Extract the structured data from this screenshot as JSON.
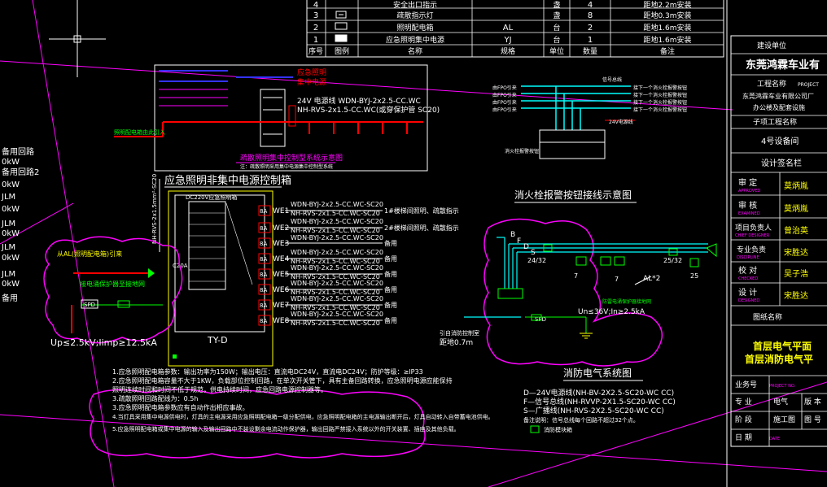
{
  "colors": {
    "bg": "#000000",
    "line_white": "#ffffff",
    "line_magenta": "#ff00ff",
    "line_cyan": "#00ffff",
    "line_green": "#00ff00",
    "line_red": "#ff0000",
    "line_yellow": "#ffff00",
    "line_blue": "#3333ff"
  },
  "top_table": {
    "rows": [
      {
        "no": "4",
        "name": "安全出口指示",
        "model": "",
        "unit": "盏",
        "qty": "4",
        "note": "距地2.2m安装"
      },
      {
        "no": "3",
        "name": "疏散指示灯",
        "model": "",
        "unit": "盏",
        "qty": "8",
        "note": "距地0.3m安装"
      },
      {
        "no": "2",
        "name": "照明配电箱",
        "model": "AL",
        "unit": "台",
        "qty": "2",
        "note": "距地1.6m安装"
      },
      {
        "no": "1",
        "name": "应急照明集中电源",
        "model": "YJ",
        "unit": "台",
        "qty": "1",
        "note": "距地1.6m安装"
      }
    ],
    "header": {
      "no": "序号",
      "symbol": "图例",
      "name": "名称",
      "model": "规格",
      "unit": "单位",
      "qty": "数量",
      "note": "备注"
    }
  },
  "left_edge_labels": [
    "备用回路",
    "0kW",
    "备用回路2",
    "0kW",
    "JLM",
    "0kW",
    "JLM",
    "0kW",
    "JLM",
    "0kW",
    "备用"
  ],
  "diagram_top": {
    "wire1": "24V 电源线 WDN-BYJ-2x2.5-CC.WC",
    "wire2": "NH-RVS-2x1.5-CC.WC(或穿保护管 SC20)",
    "label_red": "应急照明",
    "label_red2": "集中电源",
    "caption": "疏散照明集中控制型系统示意图",
    "note": "注：疏散照明采用集中电源集中控制型系统",
    "label_left": "照明配电箱由此引入"
  },
  "main_box": {
    "title": "应急照明非集中电源控制箱",
    "name": "TY-D",
    "header": "DC220V应急照明箱",
    "breaker": "C20A",
    "circuits": [
      {
        "id": "WE1",
        "breaker": "8A",
        "cable": "WDN-BYJ-2x2.5-CC.WC-SC20",
        "cable2": "NH-RVS-2x1.5-CC.WC-SC20",
        "desc": "1#楼梯间照明、疏散指示"
      },
      {
        "id": "WE2",
        "breaker": "8A",
        "cable": "WDN-BYJ-2x2.5-CC.WC-SC20",
        "cable2": "NH-RVS-2x1.5-CC.WC-SC20",
        "desc": "2#楼梯间照明、疏散指示"
      },
      {
        "id": "WE3",
        "breaker": "8A",
        "cable": "WDN-BYJ-2x2.5-CC.WC-SC20",
        "cable2": "",
        "desc": "备用"
      },
      {
        "id": "WE4",
        "breaker": "8A",
        "cable": "WDN-BYJ-2x2.5-CC.WC-SC20",
        "cable2": "NH-RVS-2x1.5-CC.WC-SC20",
        "desc": "备用"
      },
      {
        "id": "WE5",
        "breaker": "8A",
        "cable": "WDN-BYJ-2x2.5-CC.WC-SC20",
        "cable2": "NH-RVS-2x1.5-CC.WC-SC20",
        "desc": "备用"
      },
      {
        "id": "WE6",
        "breaker": "8A",
        "cable": "WDN-BYJ-2x2.5-CC.WC-SC20",
        "cable2": "NH-RVS-2x1.5-CC.WC-SC20",
        "desc": "备用"
      },
      {
        "id": "WE7",
        "breaker": "8A",
        "cable": "WDN-BYJ-2x2.5-CC.WC-SC20",
        "cable2": "NH-RVS-2x1.5-CC.WC-SC20",
        "desc": "备用"
      },
      {
        "id": "WE8",
        "breaker": "8A",
        "cable": "WDN-BYJ-2x2.5-CC.WC-SC20",
        "cable2": "NH-RVS-2x1.5-CC.WC-SC20",
        "desc": "备用"
      }
    ],
    "incoming": "NH-RVS-2x1.5mm²-SC20",
    "label_left1": "从AL(照明配电箱)引来",
    "label_spd": "SPD",
    "label_spd_note": "接电涌保护器至接地网",
    "spec": "Up≤2.5kV;Iimp≥12.5kA"
  },
  "notes": {
    "lines": [
      "1.应急照明配电箱参数：输出功率为150W；输出电压：直流电DC24V，直流电DC24V；防护等级：≥IP33",
      "2.应急照明配电箱容量不大于1KW，负载部位控制回路，在单次开关管下，具有主备回路转换，应急照明电源应能保持",
      "照明连续时间和时间不低于规范，供电持续时间，应急回路电源控制器等。",
      "3.疏散照明回路配线为：0.5h",
      "3.应急照明配电箱参数应有自动作出相应事故。",
      "4.当灯具采用集中电源供电时，灯具的主电源采用应急照明配电箱一级分配供电，应急照明配电箱的主电源输出断开后，灯具自动转入自带蓄电池供电。",
      "5.应急照明配电箱或集中电源的输入及输出回路中不装设剩余电流动作保护器，输出回路严禁接入系统以外的开关装置、插座及其他负载。"
    ]
  },
  "hydrant": {
    "caption": "消火栓报警按钮接线示意图",
    "rows": [
      "由FPO引来",
      "由FPO引来",
      "由FPO引来",
      "由FPO引来"
    ],
    "outs": [
      "接下一个消火栓报警按钮",
      "接下一个消火栓报警按钮",
      "接下一个消火栓报警按钮",
      "接下一个消火栓报警按钮"
    ],
    "label_top": "信号总线",
    "label_24v": "24V电源线",
    "label_box": "消火栓报警按钮"
  },
  "fire_system": {
    "caption": "消防电气系统图",
    "letters": [
      "B",
      "F",
      "D",
      "S"
    ],
    "labels": [
      "24/32",
      "7",
      "7",
      "25/32",
      "25",
      "AL*2"
    ],
    "spd_label": "SPD",
    "spd_spec": "Un≤36V;In≥2.5kA",
    "spd_note": "防雷电涌保护器接地网",
    "ground_note": "引自消防控制室",
    "ground_note2": "距地0.7m",
    "legend": [
      "D—24V电源线(NH-BV-2X2.5-SC20-WC CC)",
      "F—信号总线(NH-RVVP-2X1.5-SC20-WC CC)",
      "S—广播线(NH-RVS-2X2.5-SC20-WC CC)"
    ],
    "legend_note": "备注说明：信号总线每个回路不超过32个点。",
    "legend_box": "消防模块箱"
  },
  "title_block": {
    "builder_label": "建设单位",
    "builder": "东莞鸿霖车业有",
    "project_label": "工程名称",
    "project_en": "PROJECT",
    "project": "东莞鸿霖车业有限公司厂",
    "project2": "办公楼及配套设施",
    "sub_label": "子项工程名称",
    "sub": "4号设备间",
    "sig_label": "设计签名栏",
    "sign_rows": [
      {
        "role": "审 定",
        "en": "APPROVED",
        "name": "莫炳胤"
      },
      {
        "role": "审 核",
        "en": "EXAMINED",
        "name": "莫炳胤"
      },
      {
        "role": "项目负责人",
        "en": "CHIEF DESIGNER",
        "name": "曾治英"
      },
      {
        "role": "专业负责",
        "en": "DISCIPLINE",
        "name": "宋胜达"
      },
      {
        "role": "校 对",
        "en": "CHECKED",
        "name": "吴子浩"
      },
      {
        "role": "设 计",
        "en": "DESIGNED",
        "name": "宋胜达"
      }
    ],
    "drawing_label": "图纸名称",
    "drawing_title1": "首层电气平面",
    "drawing_title2": "首层消防电气平",
    "job_label": "业务号",
    "job_en": "PROJECT NO.",
    "discipline_label": "专 业",
    "discipline": "电气",
    "version_label": "版 本",
    "stage_label": "阶 段",
    "stage": "施工图",
    "sheet_label": "图 号",
    "date_label": "日 期",
    "date_en": "DATE"
  }
}
